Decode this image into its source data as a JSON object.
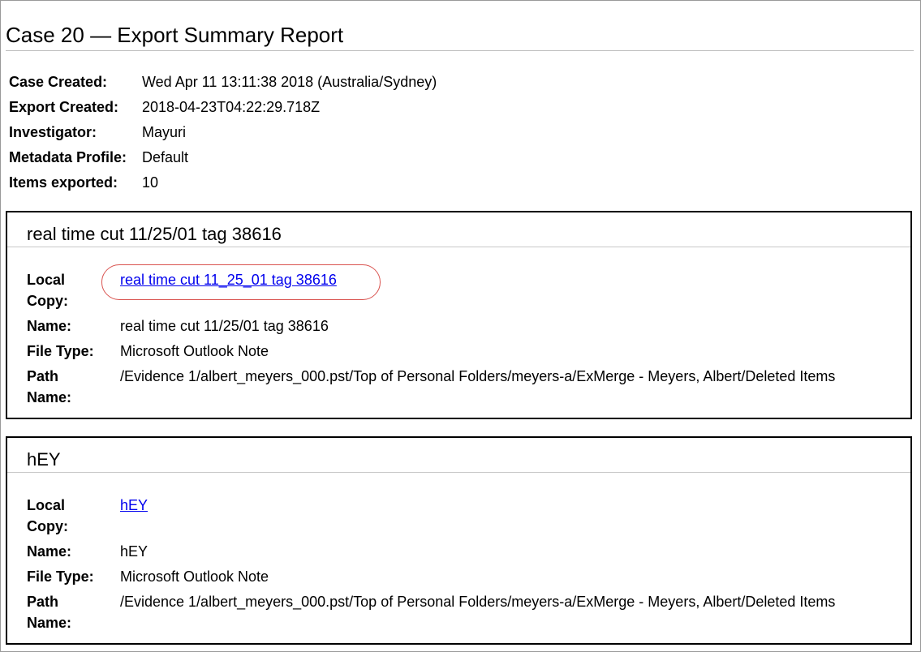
{
  "report": {
    "title": "Case 20 — Export Summary Report",
    "meta": [
      {
        "label": "Case Created:",
        "value": "Wed Apr 11 13:11:38 2018 (Australia/Sydney)"
      },
      {
        "label": "Export Created:",
        "value": "2018-04-23T04:22:29.718Z"
      },
      {
        "label": "Investigator:",
        "value": "Mayuri"
      },
      {
        "label": "Metadata Profile:",
        "value": "Default"
      },
      {
        "label": "Items exported:",
        "value": "10"
      }
    ]
  },
  "labels": {
    "local_copy_1": "Local",
    "local_copy_2": "Copy:",
    "name": "Name:",
    "file_type": "File Type:",
    "path_1": "Path",
    "path_2": "Name:"
  },
  "items": [
    {
      "heading": "real time cut 11/25/01 tag 38616",
      "local_copy": "real time cut 11_25_01 tag 38616",
      "name": "real time cut 11/25/01 tag 38616",
      "file_type": "Microsoft Outlook Note",
      "path": "/Evidence 1/albert_meyers_000.pst/Top of Personal Folders/meyers-a/ExMerge - Meyers, Albert/Deleted Items",
      "highlight_color": "#d9534f"
    },
    {
      "heading": "hEY",
      "local_copy": "hEY",
      "name": "hEY",
      "file_type": "Microsoft Outlook Note",
      "path": "/Evidence 1/albert_meyers_000.pst/Top of Personal Folders/meyers-a/ExMerge - Meyers, Albert/Deleted Items"
    }
  ],
  "colors": {
    "link": "#0000ee",
    "highlight": "#d9534f"
  }
}
